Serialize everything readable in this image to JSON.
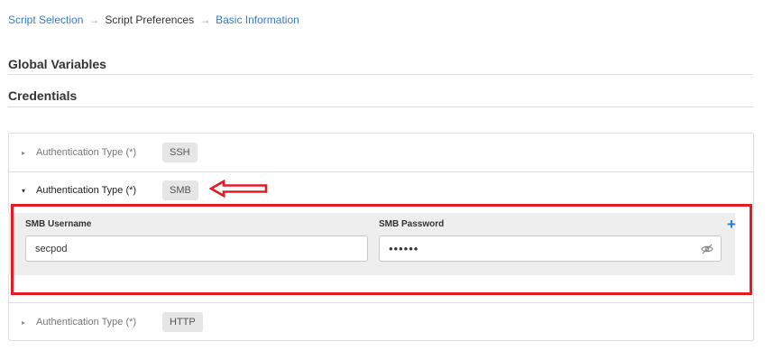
{
  "breadcrumb": {
    "step1": "Script Selection",
    "step2": "Script Preferences",
    "step3": "Basic Information",
    "separator": "→"
  },
  "sections": {
    "global_variables": "Global Variables",
    "credentials": "Credentials"
  },
  "auth_entries": [
    {
      "label": "Authentication Type (*)",
      "type": "SSH",
      "expanded": false
    },
    {
      "label": "Authentication Type (*)",
      "type": "SMB",
      "expanded": true
    },
    {
      "label": "Authentication Type (*)",
      "type": "HTTP",
      "expanded": false
    }
  ],
  "smb_form": {
    "username_label": "SMB Username",
    "username_value": "secpod",
    "password_label": "SMB Password",
    "password_value": "••••••"
  },
  "icons": {
    "collapsed_caret": "▸",
    "expanded_caret": "▾",
    "add": "+",
    "password_visibility": "eye-off-icon"
  },
  "colors": {
    "link": "#3b7bbf",
    "annotation_red": "#e31b23",
    "add_blue": "#2a7bd0"
  }
}
